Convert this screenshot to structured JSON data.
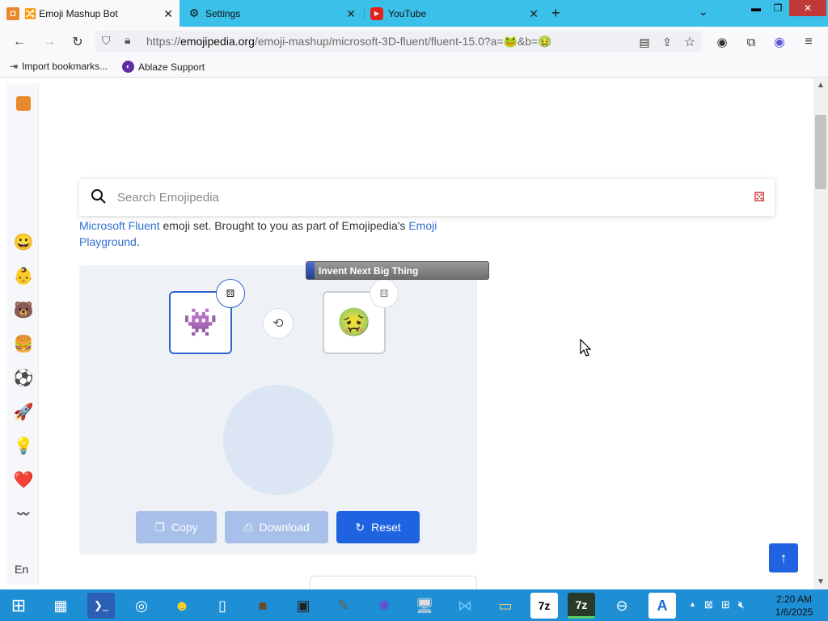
{
  "tabs": [
    {
      "label": "🔀 Emoji Mashup Bot",
      "active": true
    },
    {
      "label": "Settings",
      "active": false
    },
    {
      "label": "YouTube",
      "active": false
    }
  ],
  "nav": {
    "url_prefix": "https://",
    "url_domain": "emojipedia.org",
    "url_path": "/emoji-mashup/microsoft-3D-fluent/fluent-15.0?a=🐸&b=🤢"
  },
  "bookmarks": [
    {
      "label": "Import bookmarks..."
    },
    {
      "label": "Ablaze Support"
    }
  ],
  "sidebar": {
    "items": [
      "😀",
      "👶",
      "🐻",
      "🍔",
      "⚽",
      "🚀",
      "💡",
      "❤️",
      "〰️"
    ],
    "lang": "En"
  },
  "search": {
    "placeholder": "Search Emojipedia"
  },
  "description": {
    "link1": "Microsoft Fluent",
    "text1": " emoji set. Brought to you as part of Emojipedia's ",
    "link2": "Emoji",
    "link3": "Playground",
    "text2": "."
  },
  "mashup": {
    "emoji_a": "👾",
    "emoji_b": "🤢",
    "copy_label": "Copy",
    "download_label": "Download",
    "reset_label": "Reset"
  },
  "tooltip": {
    "text": "Invent Next Big Thing"
  },
  "clock": {
    "time": "2:20 AM",
    "date": "1/6/2025"
  },
  "colors": {
    "accent": "#1f63e0",
    "tabbar": "#3bc0ea",
    "taskbar": "#1e8fd4"
  }
}
